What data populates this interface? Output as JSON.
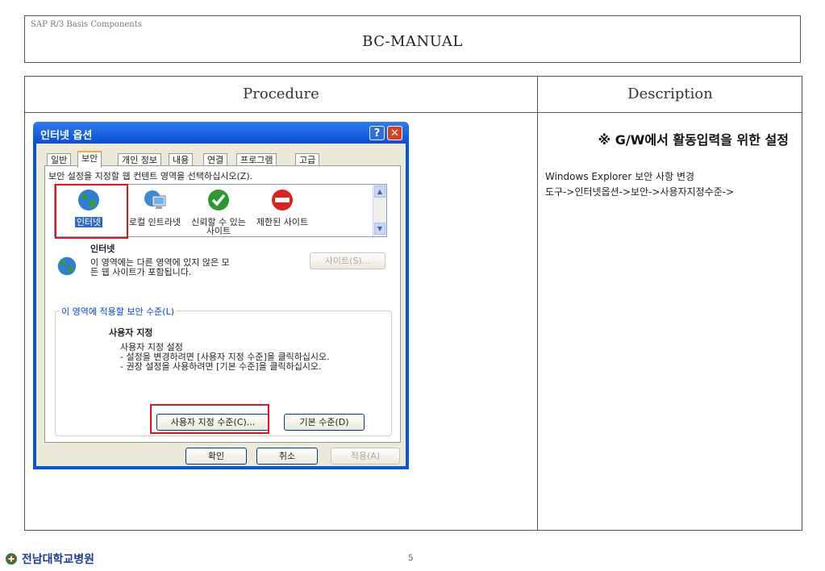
{
  "header": {
    "subtitle": "SAP R/3 Basis Components",
    "title": "BC-MANUAL"
  },
  "table": {
    "col_procedure": "Procedure",
    "col_description": "Description",
    "description": {
      "title": "※ G/W에서 활동입력을 위한 설정",
      "line1": "Windows Explorer 보안 사항 변경",
      "line2": "도구->인터넷옵션->보안->사용자지정수준->"
    }
  },
  "dialog": {
    "title": "인터넷 옵션",
    "help_glyph": "?",
    "close_glyph": "✕",
    "tabs": [
      "일반",
      "보안",
      "개인 정보",
      "내용",
      "연결",
      "프로그램",
      "고급"
    ],
    "selected_tab": "보안",
    "zone_prompt": "보안 설정을 지정할 웹 컨텐트 영역을 선택하십시오(Z).",
    "zones": [
      {
        "label": "인터넷",
        "icon": "globe-icon"
      },
      {
        "label": "로컬 인트라넷",
        "icon": "computer-icon"
      },
      {
        "label": "신뢰할 수 있는 사이트",
        "icon": "checkmark-icon"
      },
      {
        "label": "제한된 사이트",
        "icon": "no-entry-icon"
      }
    ],
    "zone_name": "인터넷",
    "zone_desc_1": "이 영역에는 다른 영역에 있지 않은 모",
    "zone_desc_2": "든 웹 사이트가 포함됩니다.",
    "sites_button": "사이트(S)...",
    "level_group": "이 영역에 적용할 보안 수준(L)",
    "level_title": "사용자 지정",
    "level_line1": "사용자 지정 설정",
    "level_line2": "- 설정을 변경하려면 [사용자 지정 수준]을 클릭하십시오.",
    "level_line3": "- 권장 설정을 사용하려면 [기본 수준]을 클릭하십시오.",
    "custom_level_button": "사용자 지정 수준(C)...",
    "default_level_button": "기본 수준(D)",
    "ok_button": "확인",
    "cancel_button": "취소",
    "apply_button": "적용(A)"
  },
  "footer": {
    "logo_text": "전남대학교병원",
    "page_number": "5"
  },
  "colors": {
    "title_bar": "#0a55d6",
    "highlight_box": "#e0161f",
    "dialog_face": "#ece9d8"
  }
}
